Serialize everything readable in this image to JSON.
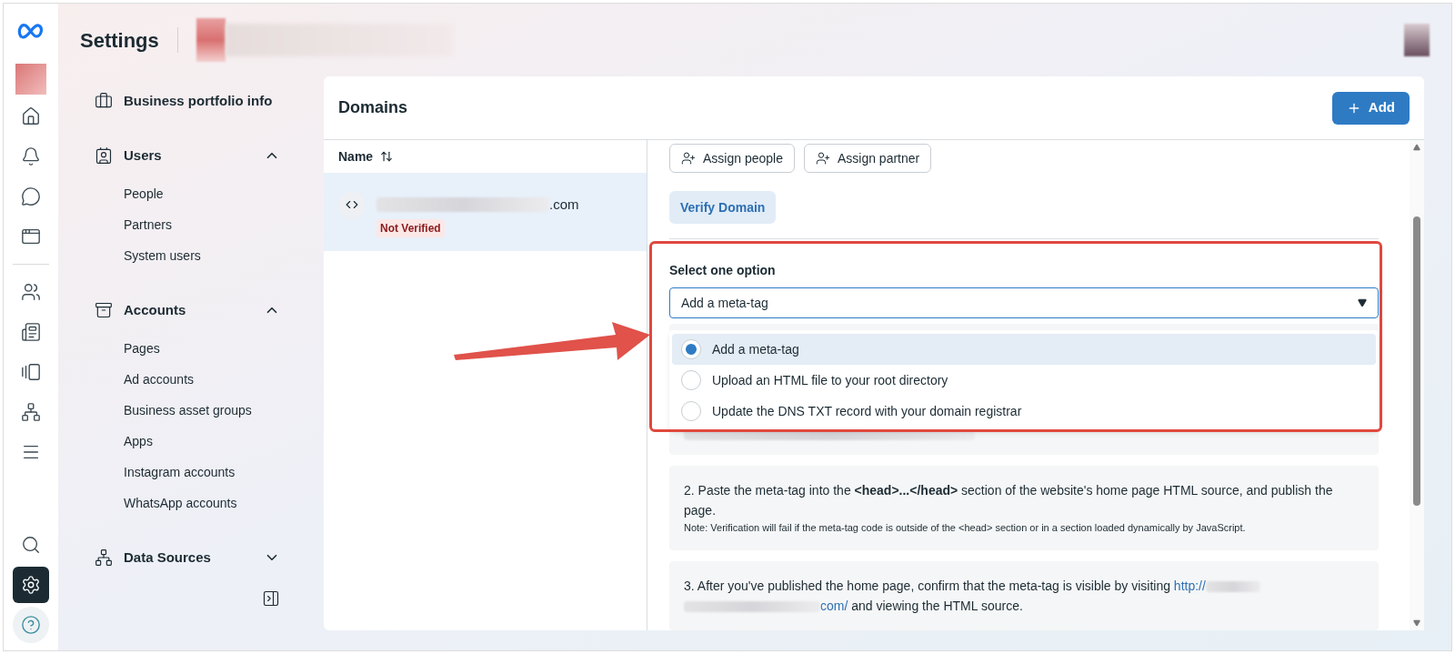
{
  "header": {
    "title": "Settings"
  },
  "rail": [
    {
      "kind": "home",
      "selected": false
    },
    {
      "kind": "bell",
      "selected": false
    },
    {
      "kind": "chat",
      "selected": false
    },
    {
      "kind": "windows",
      "selected": false
    },
    {
      "kind": "people",
      "selected": false
    },
    {
      "kind": "pages",
      "selected": false
    },
    {
      "kind": "media",
      "selected": false
    },
    {
      "kind": "network",
      "selected": false
    },
    {
      "kind": "menu",
      "selected": false
    },
    {
      "kind": "search",
      "selected": false
    },
    {
      "kind": "settings",
      "selected": true
    },
    {
      "kind": "help",
      "selected": false
    }
  ],
  "sidebar": {
    "items": [
      {
        "label": "Business portfolio info",
        "kind": "briefcase"
      },
      {
        "label": "Users",
        "kind": "badge",
        "expanded": true,
        "children": [
          {
            "label": "People"
          },
          {
            "label": "Partners"
          },
          {
            "label": "System users"
          }
        ]
      },
      {
        "label": "Accounts",
        "kind": "archive",
        "expanded": true,
        "children": [
          {
            "label": "Pages"
          },
          {
            "label": "Ad accounts"
          },
          {
            "label": "Business asset groups"
          },
          {
            "label": "Apps"
          },
          {
            "label": "Instagram accounts"
          },
          {
            "label": "WhatsApp accounts"
          }
        ]
      },
      {
        "label": "Data Sources",
        "kind": "network",
        "expanded": false
      }
    ]
  },
  "panel": {
    "title": "Domains",
    "add_button": "Add",
    "column": "Name",
    "domains": [
      {
        "suffix": ".com",
        "status": "Not Verified",
        "selected": true
      }
    ],
    "actions": [
      "Assign people",
      "Assign partner"
    ],
    "verify_button": "Verify Domain",
    "select": {
      "label": "Select one option",
      "value": "Add a meta-tag",
      "expanded": true,
      "options": [
        {
          "label": "Add a meta-tag",
          "selected": true
        },
        {
          "label": "Upload an HTML file to your root directory",
          "selected": false
        },
        {
          "label": "Update the DNS TXT record with your domain registrar",
          "selected": false
        }
      ]
    },
    "step_2": {
      "text": "2. Paste the meta-tag into the **<head>...</head>** section of the website's home page HTML source, and publish the page.",
      "note": "Note: Verification will fail if the meta-tag code is outside of the <head> section or in a section loaded dynamically by JavaScript."
    },
    "step_3": {
      "text": "3. After you've published the home page, confirm that the meta-tag is visible by visiting",
      "link_start": "http://",
      "link_end": "com/",
      "text_end": "and viewing the HTML source."
    }
  }
}
